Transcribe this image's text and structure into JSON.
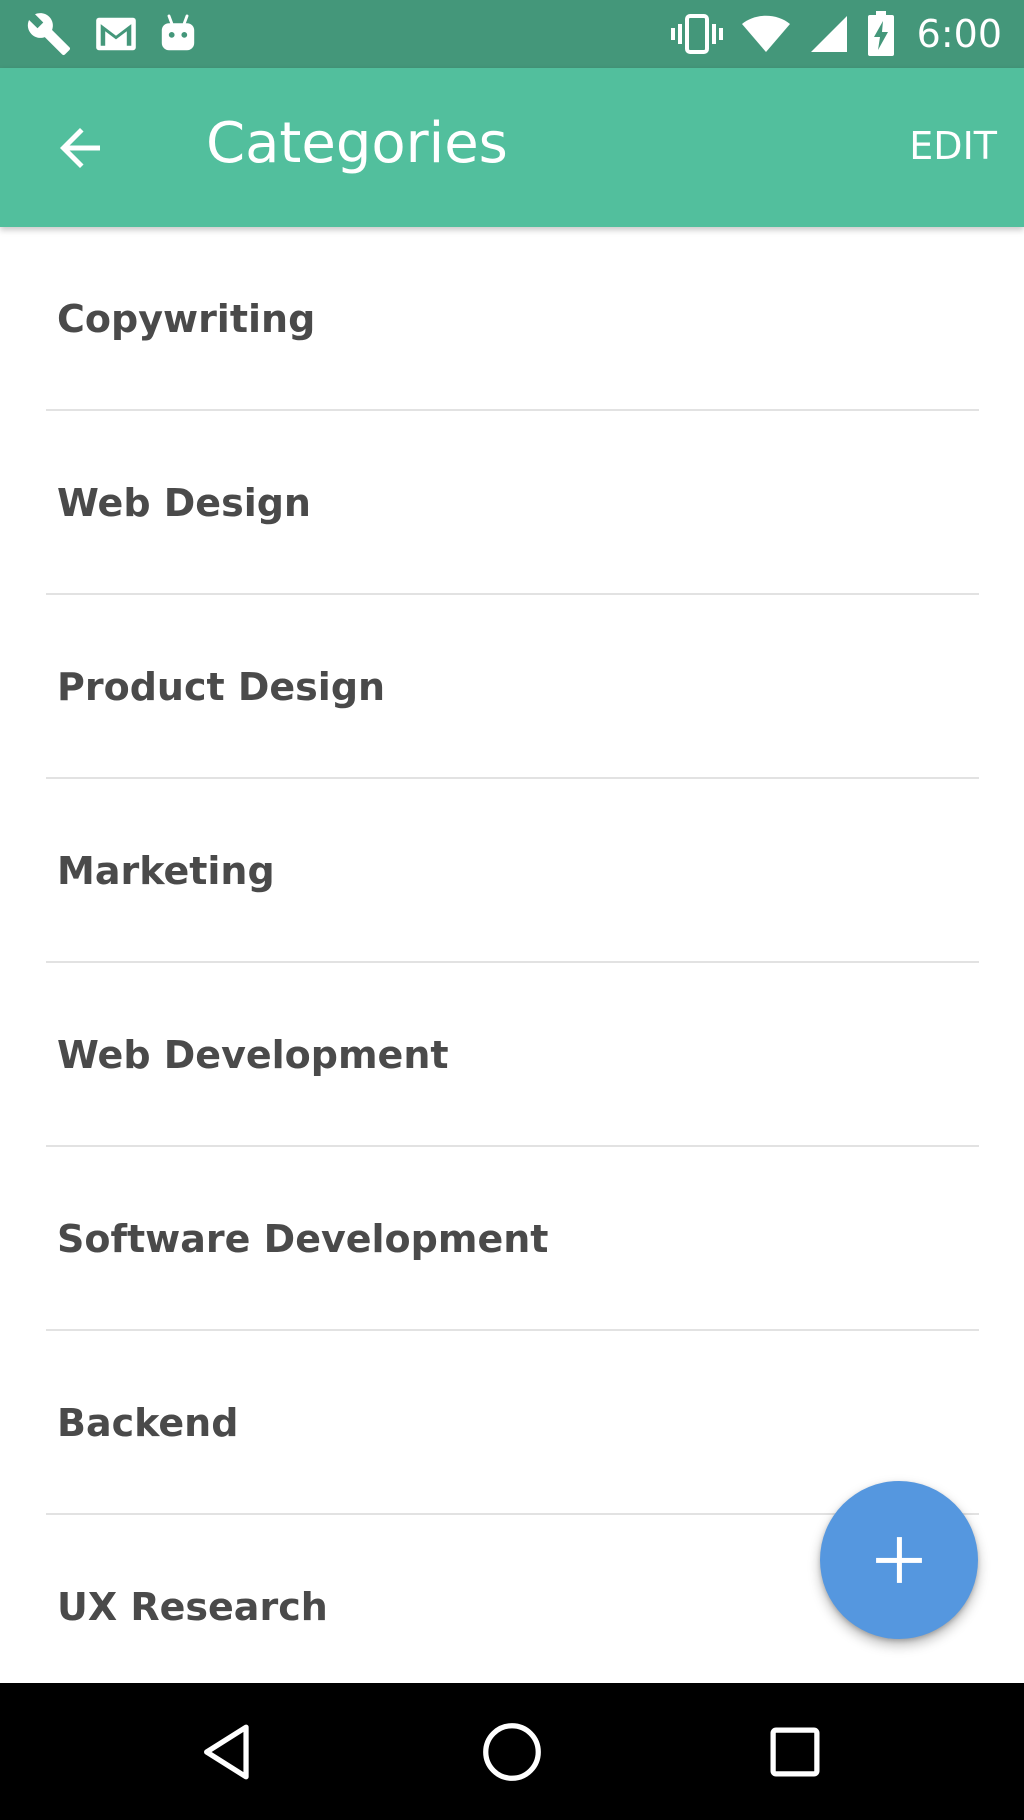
{
  "status_bar": {
    "time": "6:00",
    "left_icons": [
      "wrench-icon",
      "gmail-icon",
      "android-icon"
    ],
    "right_icons": [
      "vibrate-icon",
      "wifi-icon",
      "signal-icon",
      "battery-charging-icon"
    ],
    "background": "#44977a"
  },
  "app_bar": {
    "title": "Categories",
    "back_icon": "arrow-back-icon",
    "action_label": "EDIT",
    "background": "#52bf9d"
  },
  "categories": [
    {
      "label": "Copywriting"
    },
    {
      "label": "Web Design"
    },
    {
      "label": "Product Design"
    },
    {
      "label": "Marketing"
    },
    {
      "label": "Web Development"
    },
    {
      "label": "Software Development"
    },
    {
      "label": "Backend"
    },
    {
      "label": "UX Research"
    }
  ],
  "fab": {
    "icon": "plus-icon",
    "color": "#5597df"
  },
  "nav_bar": {
    "icons": [
      "nav-back-icon",
      "nav-home-icon",
      "nav-recents-icon"
    ]
  }
}
